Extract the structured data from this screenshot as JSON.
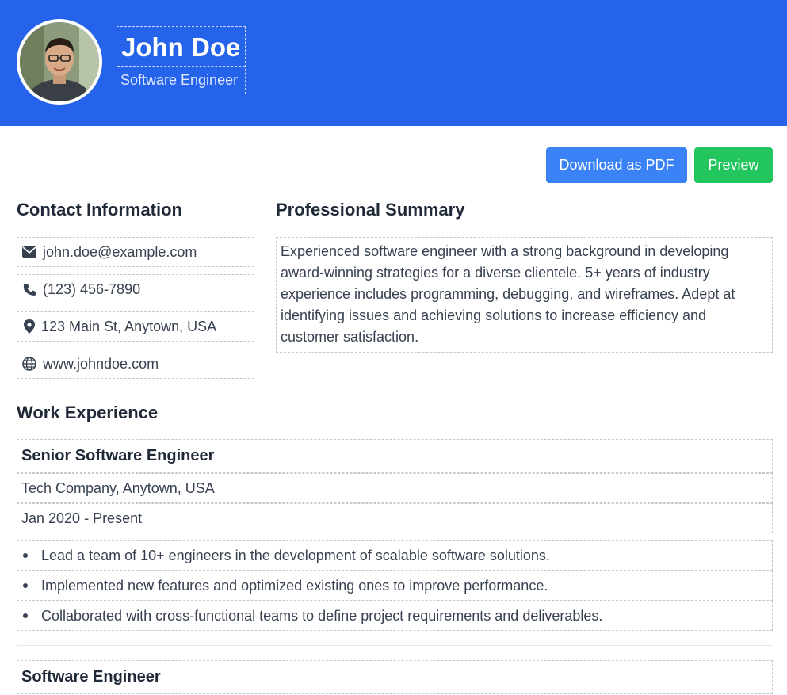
{
  "header": {
    "name": "John Doe",
    "title": "Software Engineer",
    "accent_color": "#2563eb"
  },
  "actions": {
    "download_label": "Download as PDF",
    "preview_label": "Preview"
  },
  "contact": {
    "heading": "Contact Information",
    "items": [
      {
        "icon": "envelope-icon",
        "text": "john.doe@example.com"
      },
      {
        "icon": "phone-icon",
        "text": "(123) 456-7890"
      },
      {
        "icon": "location-pin-icon",
        "text": "123 Main St, Anytown, USA"
      },
      {
        "icon": "globe-icon",
        "text": "www.johndoe.com"
      }
    ]
  },
  "summary": {
    "heading": "Professional Summary",
    "text": "Experienced software engineer with a strong background in developing award-winning strategies for a diverse clientele. 5+ years of industry experience includes programming, debugging, and wireframes. Adept at identifying issues and achieving solutions to increase efficiency and customer satisfaction."
  },
  "experience": {
    "heading": "Work Experience",
    "jobs": [
      {
        "title": "Senior Software Engineer",
        "company": "Tech Company, Anytown, USA",
        "dates": "Jan 2020 - Present",
        "bullets": [
          "Lead a team of 10+ engineers in the development of scalable software solutions.",
          "Implemented new features and optimized existing ones to improve performance.",
          "Collaborated with cross-functional teams to define project requirements and deliverables."
        ]
      },
      {
        "title": "Software Engineer"
      }
    ]
  }
}
